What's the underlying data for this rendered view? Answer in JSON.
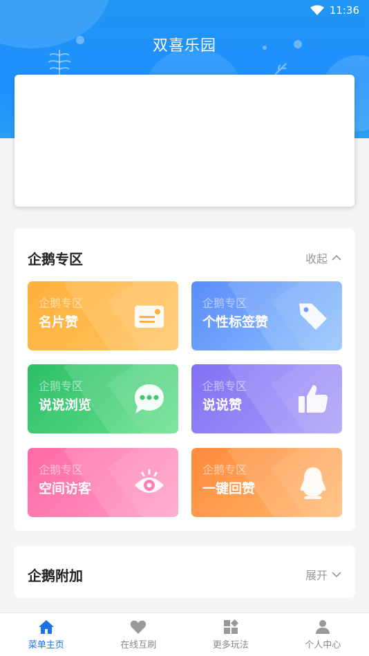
{
  "status_bar": {
    "time": "11:36",
    "wifi_icon": "wifi-icon"
  },
  "header": {
    "title": "双喜乐园"
  },
  "qq_zone": {
    "title": "企鹅专区",
    "toggle_label": "收起",
    "toggle_icon": "chevron-up-icon",
    "tiles": [
      {
        "sub": "企鹅专区",
        "label": "名片赞",
        "icon": "card-icon",
        "color": "#ffb13c"
      },
      {
        "sub": "企鹅专区",
        "label": "个性标签赞",
        "icon": "tag-icon",
        "color": "#5b8dfb"
      },
      {
        "sub": "企鹅专区",
        "label": "说说浏览",
        "icon": "chat-bubble-icon",
        "color": "#2fbf68"
      },
      {
        "sub": "企鹅专区",
        "label": "说说赞",
        "icon": "thumbs-up-icon",
        "color": "#8270f5"
      },
      {
        "sub": "企鹅专区",
        "label": "空间访客",
        "icon": "eye-icon",
        "color": "#ff6aa3"
      },
      {
        "sub": "企鹅专区",
        "label": "一键回赞",
        "icon": "penguin-icon",
        "color": "#ff8a3c"
      }
    ]
  },
  "qq_extra": {
    "title": "企鹅附加",
    "toggle_label": "展开",
    "toggle_icon": "chevron-down-icon"
  },
  "tabbar": {
    "items": [
      {
        "label": "菜单主页",
        "icon": "home-icon",
        "active": true
      },
      {
        "label": "在线互刷",
        "icon": "heart-icon",
        "active": false
      },
      {
        "label": "更多玩法",
        "icon": "apps-icon",
        "active": false
      },
      {
        "label": "个人中心",
        "icon": "person-icon",
        "active": false
      }
    ],
    "active_color": "#1a73e8",
    "inactive_color": "#888888"
  }
}
